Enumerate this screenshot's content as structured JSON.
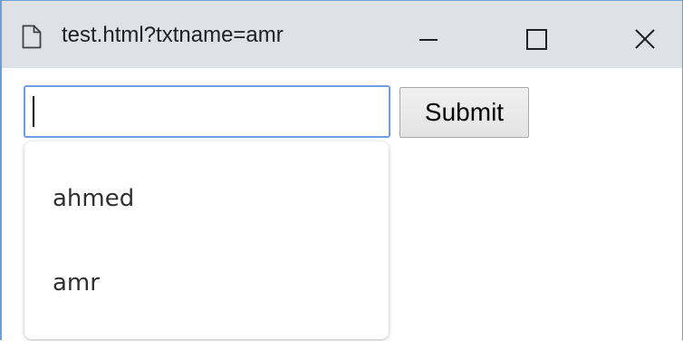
{
  "window": {
    "title": "test.html?txtname=amr",
    "icons": {
      "page": "page-icon",
      "minimize": "minimize-icon",
      "maximize": "maximize-icon",
      "close": "close-icon"
    }
  },
  "form": {
    "input_value": "",
    "submit_label": "Submit"
  },
  "autocomplete": {
    "suggestions": [
      "ahmed",
      "amr"
    ]
  },
  "colors": {
    "titlebar": "#dee1e6",
    "focus_border": "#6d9de3",
    "window_border": "#6a9fd9"
  }
}
